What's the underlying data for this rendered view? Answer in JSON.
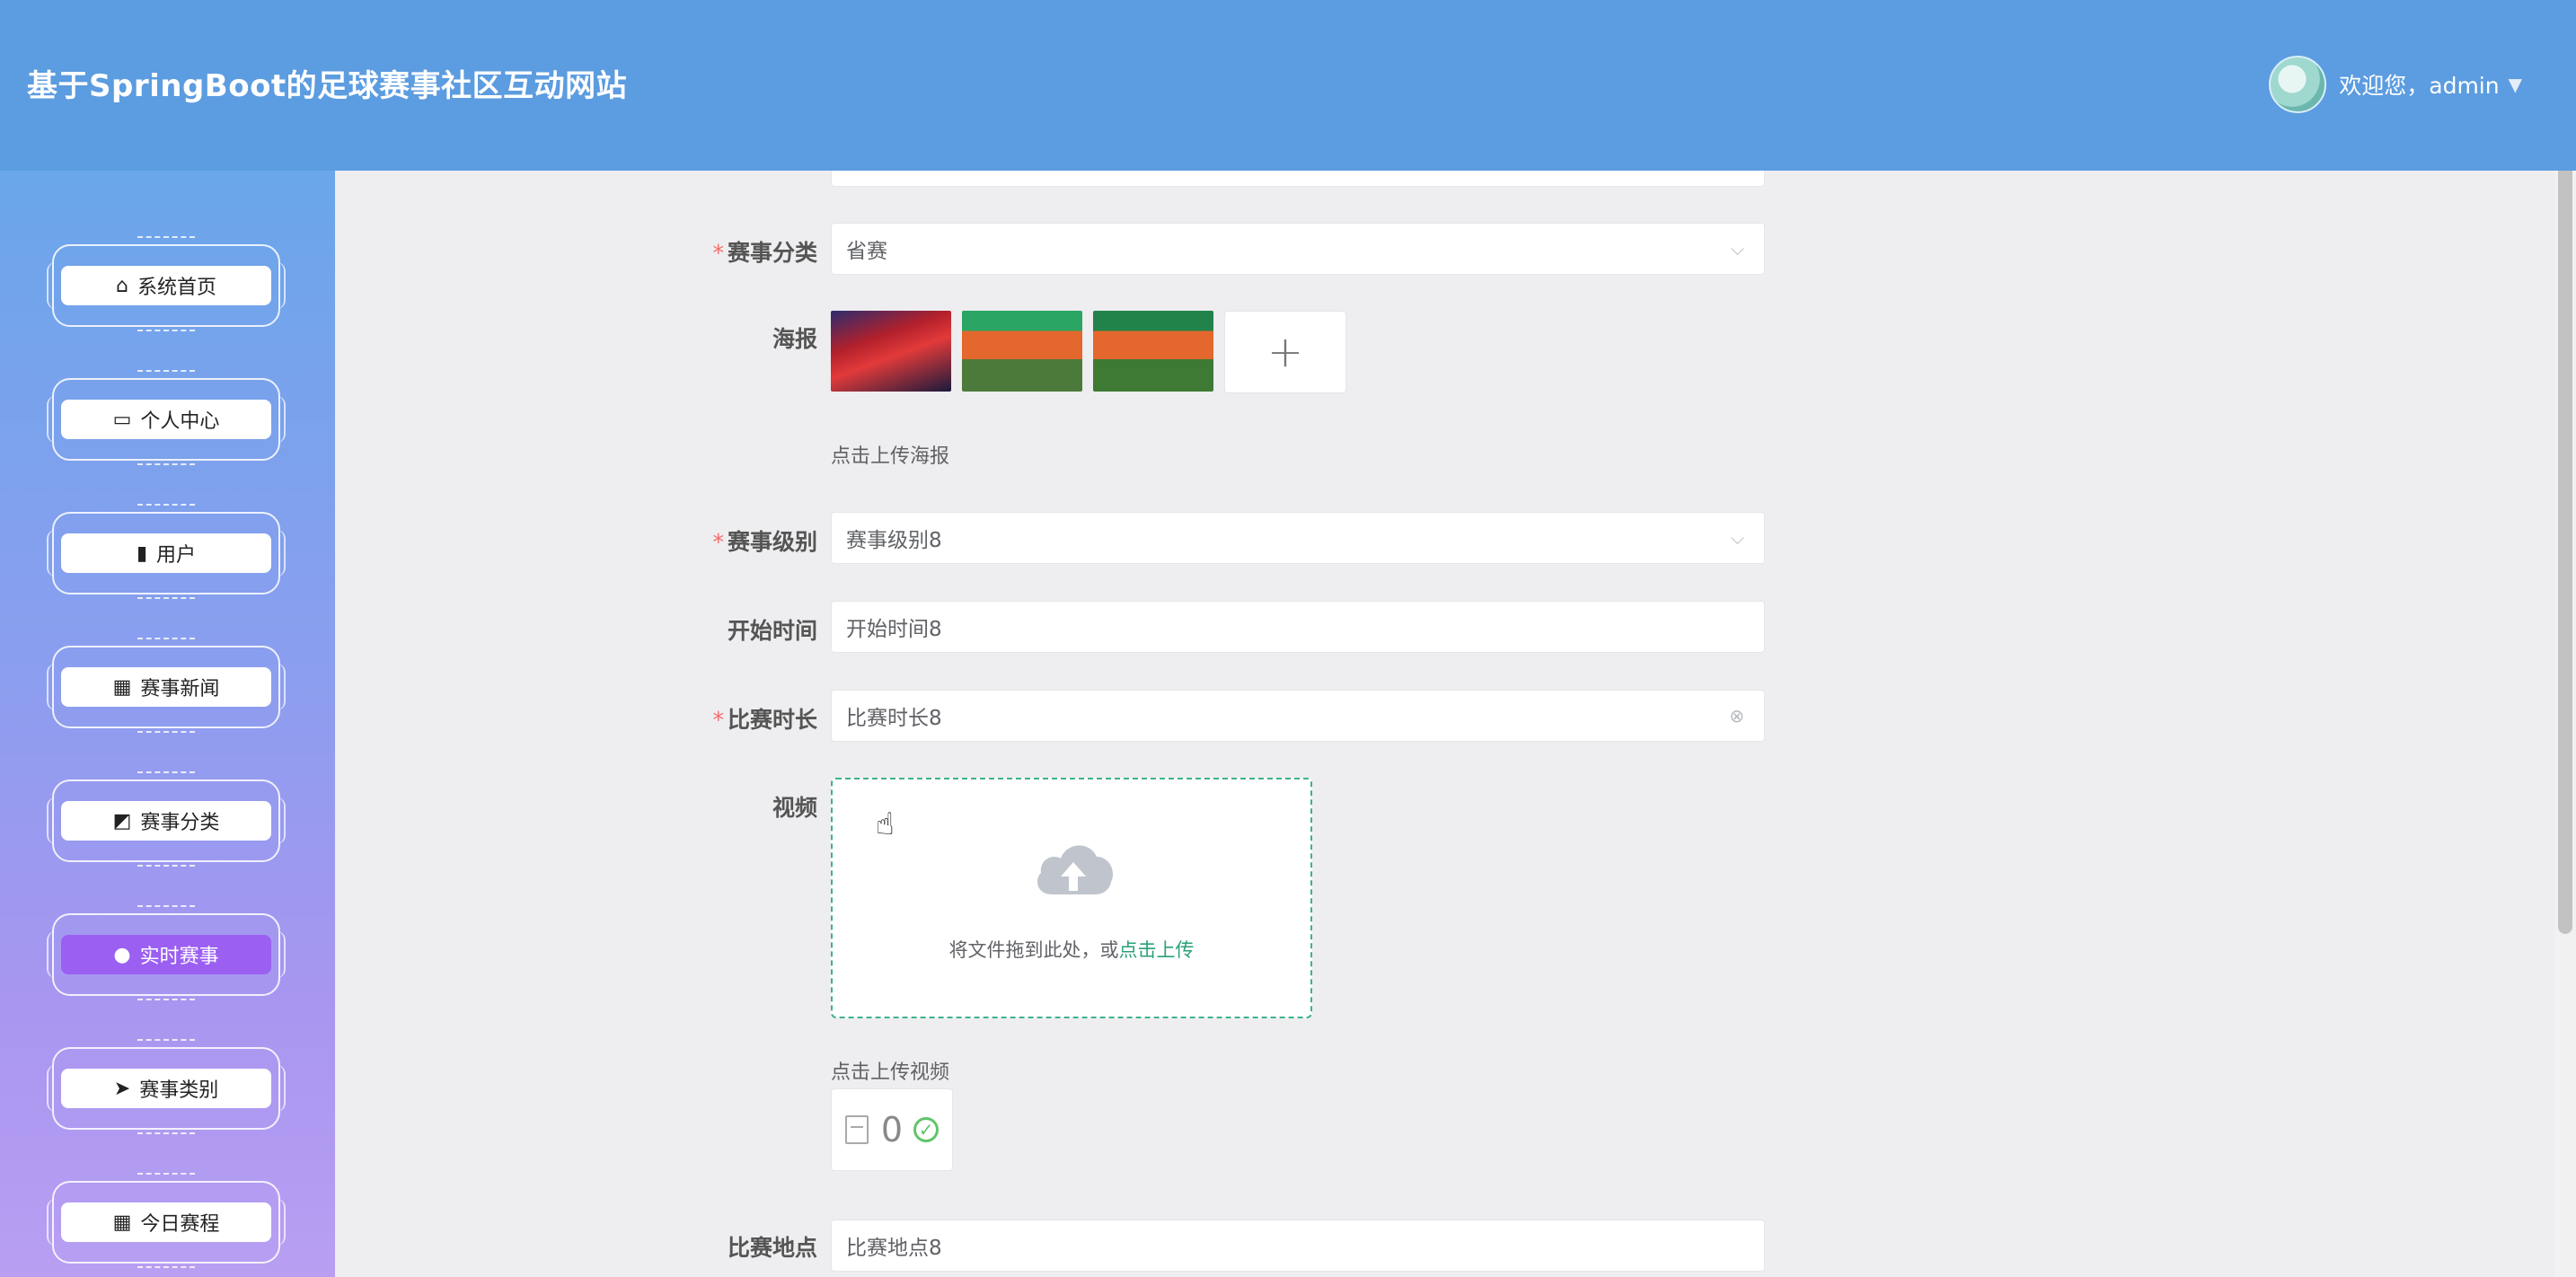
{
  "header": {
    "title": "基于SpringBoot的足球赛事社区互动网站",
    "welcome": "欢迎您，admin",
    "caret": "▼"
  },
  "sidebar": {
    "items": [
      {
        "label": "系统首页",
        "icon": "home-icon",
        "glyph": "⌂",
        "active": false
      },
      {
        "label": "个人中心",
        "icon": "wallet-icon",
        "glyph": "▭",
        "active": false
      },
      {
        "label": "用户",
        "icon": "bar-chart-icon",
        "glyph": "▮",
        "active": false
      },
      {
        "label": "赛事新闻",
        "icon": "grid-icon",
        "glyph": "▦",
        "active": false
      },
      {
        "label": "赛事分类",
        "icon": "tag-icon",
        "glyph": "◩",
        "active": false
      },
      {
        "label": "实时赛事",
        "icon": "user-icon",
        "glyph": "●",
        "active": true
      },
      {
        "label": "赛事类别",
        "icon": "send-icon",
        "glyph": "➤",
        "active": false
      },
      {
        "label": "今日赛程",
        "icon": "grid-icon",
        "glyph": "▦",
        "active": false
      }
    ]
  },
  "form": {
    "category": {
      "label": "赛事分类",
      "value": "省赛",
      "required": true
    },
    "poster": {
      "label": "海报",
      "hint": "点击上传海报",
      "count": 3
    },
    "level": {
      "label": "赛事级别",
      "value": "赛事级别8",
      "required": true
    },
    "start_time": {
      "label": "开始时间",
      "value": "开始时间8"
    },
    "duration": {
      "label": "比赛时长",
      "value": "比赛时长8",
      "required": true
    },
    "video": {
      "label": "视频",
      "drop_text": "将文件拖到此处，或",
      "drop_link": "点击上传",
      "hint": "点击上传视频",
      "file_name": "0"
    },
    "location": {
      "label": "比赛地点",
      "value": "比赛地点8"
    }
  },
  "icons": {
    "select_arrow": "chevron-down-icon",
    "clear": "clear-circle-icon",
    "upload": "cloud-upload-icon",
    "success": "check-circle-icon",
    "file": "document-icon"
  },
  "colors": {
    "header": "#5c9ce0",
    "active_nav": "#9b5ff2",
    "required": "#f56c6c",
    "link": "#2aa07a"
  }
}
